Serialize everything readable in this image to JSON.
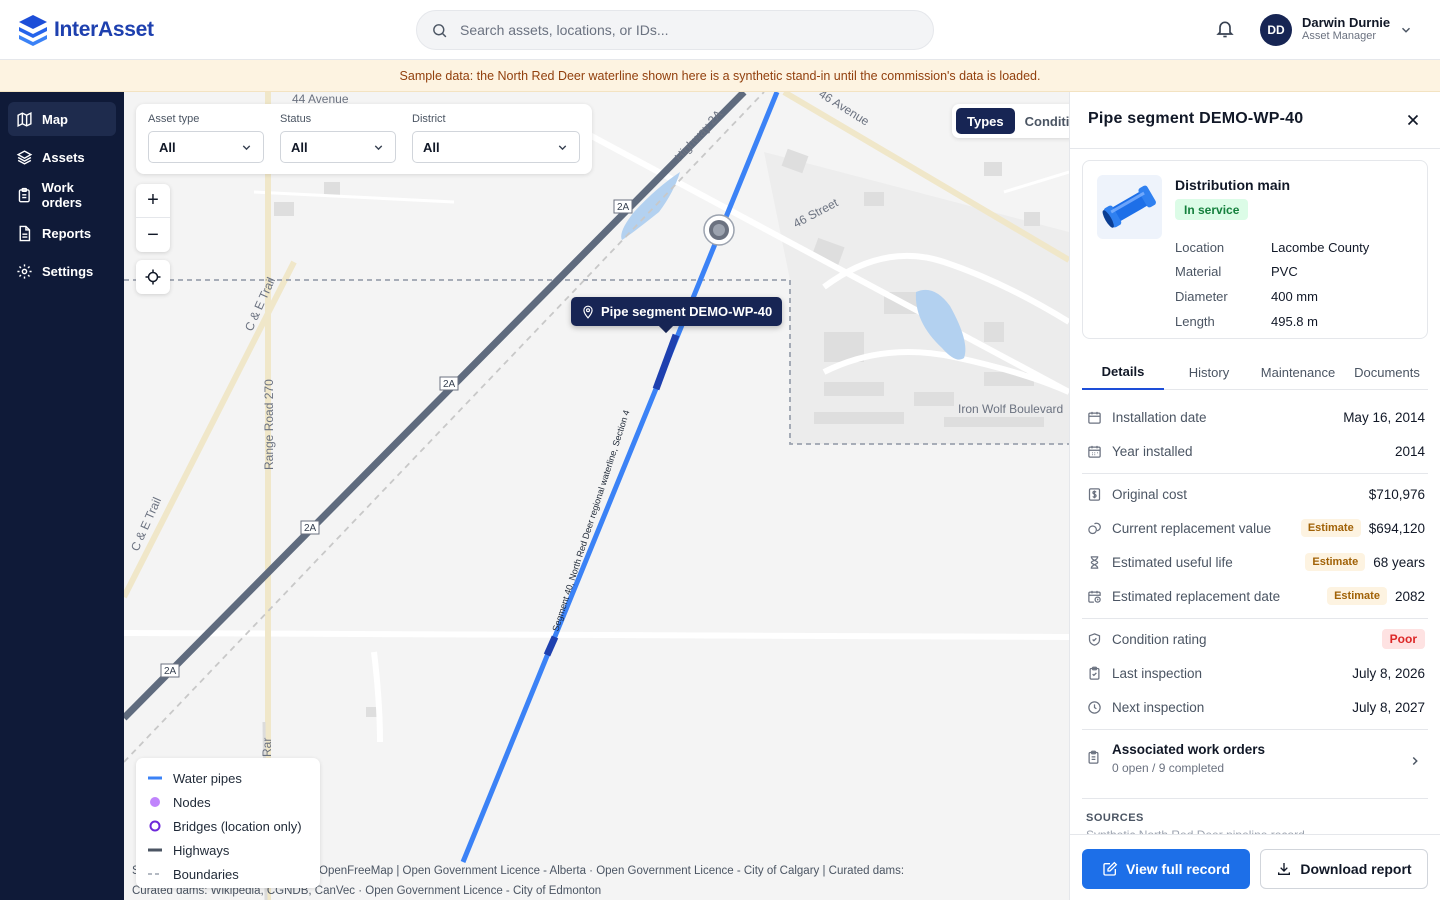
{
  "app": {
    "name": "InterAsset"
  },
  "search": {
    "placeholder": "Search assets, locations, or IDs..."
  },
  "user": {
    "initials": "DD",
    "name": "Darwin Durnie",
    "role": "Asset Manager"
  },
  "banner": {
    "text": "Sample data: the North Red Deer waterline shown here is a synthetic stand-in until the commission's data is loaded."
  },
  "sidebar": {
    "items": [
      {
        "label": "Map",
        "icon": "map-icon",
        "active": true
      },
      {
        "label": "Assets",
        "icon": "layers-icon"
      },
      {
        "label": "Work orders",
        "icon": "clipboard-icon"
      },
      {
        "label": "Reports",
        "icon": "file-icon"
      },
      {
        "label": "Settings",
        "icon": "gear-icon"
      }
    ]
  },
  "filters": {
    "asset_type": {
      "label": "Asset type",
      "value": "All"
    },
    "status": {
      "label": "Status",
      "value": "All"
    },
    "district": {
      "label": "District",
      "value": "All"
    }
  },
  "map": {
    "zoom_in": "+",
    "zoom_out": "−",
    "toggle": {
      "active": "Types",
      "inactive": "Conditi"
    },
    "tooltip": "Pipe segment DEMO-WP-40",
    "labels": {
      "avenue44": "44 Avenue",
      "avenue46": "46 Avenue",
      "street46": "46 Street",
      "highway2a": "Highway 2A",
      "shield": "2A",
      "ce_trail": "C & E Trail",
      "range_road": "Range Road 270",
      "range_road_cut": "Rar",
      "iron_wolf": "Iron Wolf Boulevard",
      "pipe_label": "Segment 40, North Red Deer regional waterline, Section 4"
    },
    "legend": [
      {
        "label": "Water pipes",
        "color": "#3b82f6"
      },
      {
        "label": "Nodes",
        "color": "#c084fc"
      },
      {
        "label": "Bridges (location only)",
        "color": "#6d28d9"
      },
      {
        "label": "Highways",
        "color": "#4b5563"
      },
      {
        "label": "Boundaries",
        "color": "#9ca3af"
      }
    ],
    "attribution_1": "S... contributors · © OpenMapTiles · OpenFreeMap | Open Government Licence - Alberta · Open Government Licence - City of Calgary | Curated dams:",
    "attribution_2": "Curated dams: Wikipedia, CGNDB, CanVec · Open Government Licence - City of Edmonton"
  },
  "panel": {
    "title": "Pipe segment DEMO-WP-40",
    "asset_type": "Distribution main",
    "status": "In service",
    "summary": [
      {
        "label": "Location",
        "value": "Lacombe County"
      },
      {
        "label": "Material",
        "value": "PVC"
      },
      {
        "label": "Diameter",
        "value": "400 mm"
      },
      {
        "label": "Length",
        "value": "495.8 m"
      }
    ],
    "tabs": [
      "Details",
      "History",
      "Maintenance",
      "Documents"
    ],
    "details": [
      {
        "label": "Installation date",
        "value": "May 16, 2014",
        "icon": "calendar-icon"
      },
      {
        "label": "Year installed",
        "value": "2014",
        "icon": "calendar-grid-icon"
      },
      {
        "label": "Original cost",
        "value": "$710,976",
        "icon": "dollar-icon"
      },
      {
        "label": "Current replacement value",
        "value": "$694,120",
        "icon": "coins-icon",
        "badge": "Estimate"
      },
      {
        "label": "Estimated useful life",
        "value": "68 years",
        "icon": "hourglass-icon",
        "badge": "Estimate"
      },
      {
        "label": "Estimated replacement date",
        "value": "2082",
        "icon": "calendar-clock-icon",
        "badge": "Estimate"
      },
      {
        "label": "Condition rating",
        "value": "Poor",
        "icon": "shield-check-icon"
      },
      {
        "label": "Last inspection",
        "value": "July 8, 2026",
        "icon": "clipboard-check-icon"
      },
      {
        "label": "Next inspection",
        "value": "July 8, 2027",
        "icon": "clock-icon"
      }
    ],
    "work_orders": {
      "title": "Associated work orders",
      "subtitle": "0 open / 9 completed"
    },
    "sources": {
      "heading": "SOURCES",
      "text": "Synthetic North Red Deer pipeline record"
    },
    "buttons": {
      "view": "View full record",
      "download": "Download report"
    }
  },
  "colors": {
    "brand": "#1e40af",
    "nav": "#0f1a38",
    "pipe": "#3b82f6",
    "accent": "#1d6fe8"
  }
}
